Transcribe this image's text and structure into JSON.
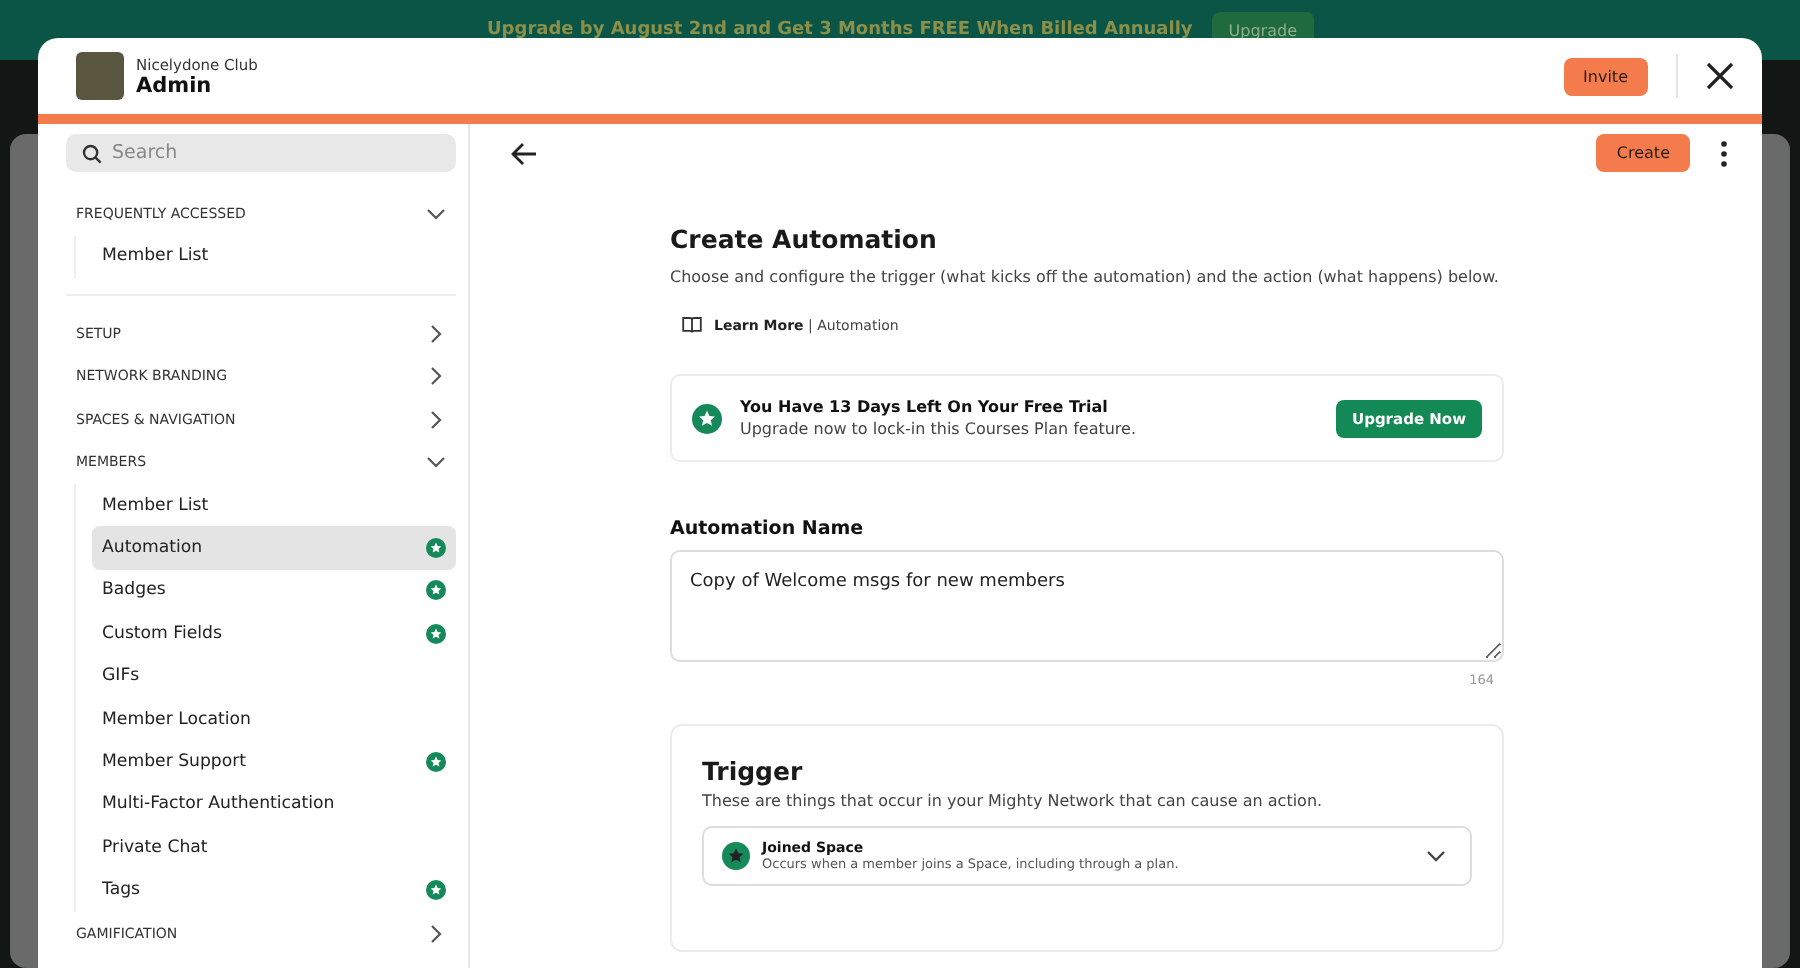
{
  "banner": {
    "message": "Upgrade by August 2nd and Get 3 Months FREE When Billed Annually",
    "button": "Upgrade"
  },
  "header": {
    "network": "Nicelydone Club",
    "title": "Admin",
    "invite_button": "Invite"
  },
  "sidebar": {
    "search": {
      "placeholder": "Search"
    },
    "pinned": {
      "label": "FREQUENTLY ACCESSED",
      "expanded": true,
      "children": [
        {
          "label": "Member List",
          "selected": false,
          "premium": false
        }
      ]
    },
    "sections": [
      {
        "label": "SETUP",
        "expanded": false
      },
      {
        "label": "NETWORK BRANDING",
        "expanded": false
      },
      {
        "label": "SPACES & NAVIGATION",
        "expanded": false
      },
      {
        "label": "MEMBERS",
        "expanded": true,
        "children": [
          {
            "label": "Member List",
            "selected": false,
            "premium": false
          },
          {
            "label": "Automation",
            "selected": true,
            "premium": true
          },
          {
            "label": "Badges",
            "selected": false,
            "premium": true
          },
          {
            "label": "Custom Fields",
            "selected": false,
            "premium": true
          },
          {
            "label": "GIFs",
            "selected": false,
            "premium": false
          },
          {
            "label": "Member Location",
            "selected": false,
            "premium": false
          },
          {
            "label": "Member Support",
            "selected": false,
            "premium": true
          },
          {
            "label": "Multi-Factor Authentication",
            "selected": false,
            "premium": false
          },
          {
            "label": "Private Chat",
            "selected": false,
            "premium": false
          },
          {
            "label": "Tags",
            "selected": false,
            "premium": true
          }
        ]
      },
      {
        "label": "GAMIFICATION",
        "expanded": false
      }
    ]
  },
  "main": {
    "create_button": "Create",
    "title": "Create Automation",
    "description": "Choose and configure the trigger (what kicks off the automation) and the action (what happens) below.",
    "learn_more": "**Learn More** | Automation",
    "trial": {
      "title": "You Have 13 Days Left On Your Free Trial",
      "subtitle": "Upgrade now to lock-in this Courses Plan feature.",
      "button": "Upgrade Now"
    },
    "name_field": {
      "label": "Automation Name",
      "value": "Copy of Welcome msgs for new members",
      "counter": "164"
    },
    "trigger": {
      "title": "Trigger",
      "description": "These are things that occur in your Mighty Network that can cause an action.",
      "option": {
        "title": "Joined Space",
        "description": "Occurs when a member joins a Space, including through a plan."
      }
    }
  }
}
